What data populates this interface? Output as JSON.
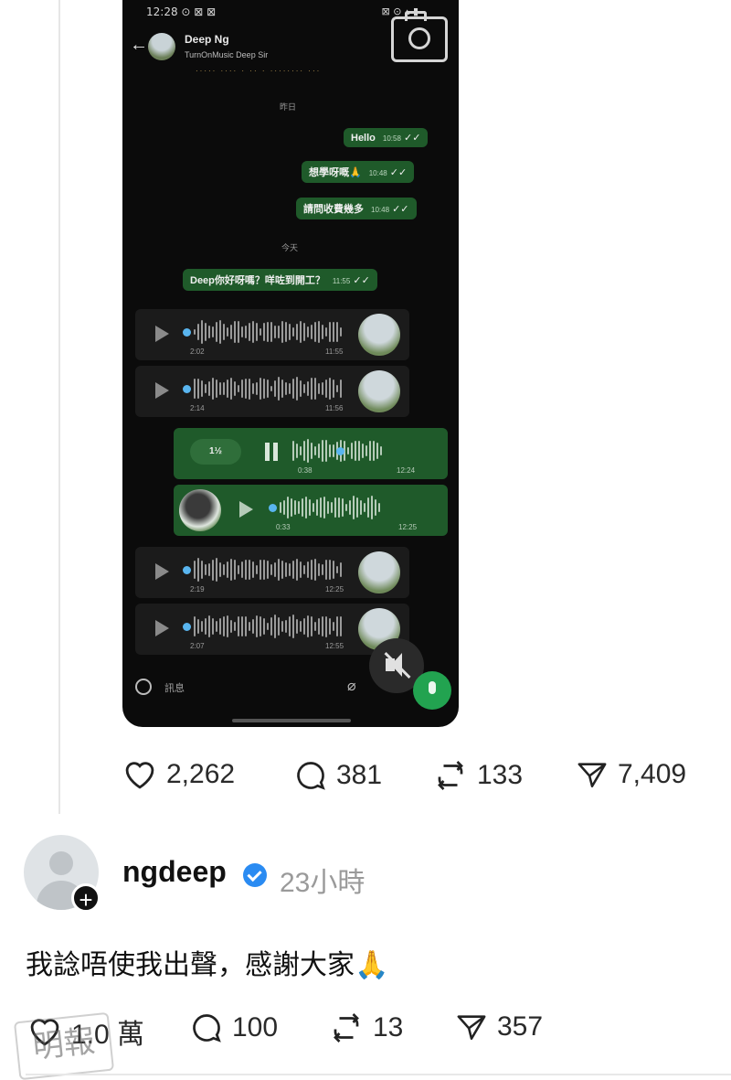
{
  "phone": {
    "status_time": "12:28 ⊙ ⊠ ⊠",
    "status_right": "⊠ ⊙ ▴ ▮",
    "contact_name": "Deep Ng",
    "contact_sub": "TurnOnMusic Deep Sir",
    "header_note": "····· ···· · ·· · ········ ···",
    "date_1": "昨日",
    "date_2": "今天",
    "messages": [
      {
        "text": "Hello",
        "time": "10:58"
      },
      {
        "text": "想學呀嘅🙏",
        "time": "10:48"
      },
      {
        "text": "請問收費幾多",
        "time": "10:48"
      },
      {
        "text": "Deep你好呀嗎？咩咗到開工？",
        "time": "11:55"
      }
    ],
    "voice_notes": [
      {
        "dur": "2:02",
        "time": "11:55"
      },
      {
        "dur": "2:14",
        "time": "11:56"
      },
      {
        "speed": "1½",
        "dur": "0:38",
        "time": "12:24"
      },
      {
        "dur": "0:33",
        "time": "12:25"
      },
      {
        "dur": "2:19",
        "time": "12:25"
      },
      {
        "dur": "2:07",
        "time": "12:55"
      }
    ],
    "input_placeholder": "訊息",
    "accent_green": "#1f5a2a",
    "mic_green": "#22a350"
  },
  "post1_actions": {
    "likes": "2,262",
    "replies": "381",
    "reposts": "133",
    "shares": "7,409"
  },
  "reply": {
    "username": "ngdeep",
    "time": "23小時",
    "text": "我諗唔使我出聲，感謝大家🙏",
    "likes": "1.0 萬",
    "replies": "100",
    "reposts": "13",
    "shares": "357"
  },
  "watermark": "明報"
}
